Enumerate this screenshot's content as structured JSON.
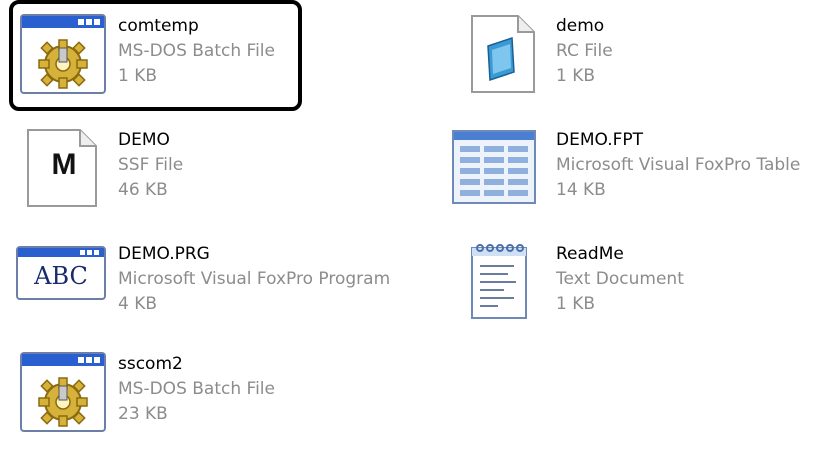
{
  "files": [
    {
      "name": "comtemp",
      "type": "MS-DOS Batch File",
      "size": "1 KB",
      "icon": "batch-file-icon"
    },
    {
      "name": "demo",
      "type": "RC File",
      "size": "1 KB",
      "icon": "rc-file-icon"
    },
    {
      "name": "DEMO",
      "type": "SSF File",
      "size": "46 KB",
      "icon": "ssf-file-icon"
    },
    {
      "name": "DEMO.FPT",
      "type": "Microsoft Visual FoxPro Table",
      "size": "14 KB",
      "icon": "foxpro-table-icon"
    },
    {
      "name": "DEMO.PRG",
      "type": "Microsoft Visual FoxPro Program",
      "size": "4 KB",
      "icon": "foxpro-program-icon"
    },
    {
      "name": "ReadMe",
      "type": "Text Document",
      "size": "1 KB",
      "icon": "text-document-icon"
    },
    {
      "name": "sscom2",
      "type": "MS-DOS Batch File",
      "size": "23 KB",
      "icon": "batch-file-icon"
    }
  ],
  "icon_glyphs": {
    "ssf_letter": "M",
    "abc_text": "ABC"
  },
  "colors": {
    "highlight_border": "#000000",
    "secondary_text": "#8c8c8c",
    "window_title_blue": "#2a5fd0"
  }
}
